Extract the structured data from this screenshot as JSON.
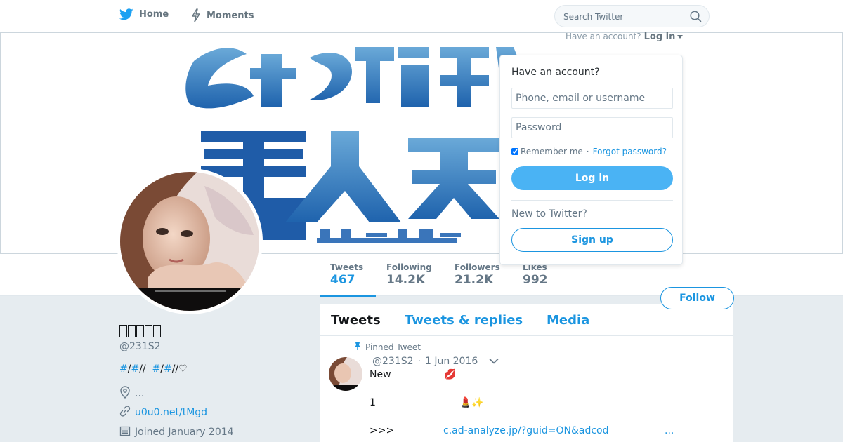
{
  "nav": {
    "home": "Home",
    "moments": "Moments",
    "search_placeholder": "Search Twitter"
  },
  "account_prompt": {
    "text": "Have an account?",
    "login": "Log in"
  },
  "login_card": {
    "heading": "Have an account?",
    "username_placeholder": "Phone, email or username",
    "password_placeholder": "Password",
    "remember": "Remember me",
    "separator": "·",
    "forgot": "Forgot password?",
    "login_button": "Log in",
    "new_label": "New to Twitter?",
    "signup_button": "Sign up"
  },
  "stats": {
    "tweets": {
      "label": "Tweets",
      "value": "467"
    },
    "following": {
      "label": "Following",
      "value": "14.2K"
    },
    "followers": {
      "label": "Followers",
      "value": "21.2K"
    },
    "likes": {
      "label": "Likes",
      "value": "992"
    }
  },
  "follow_button": "Follow",
  "profile": {
    "handle": "@231S2",
    "bio": {
      "h1": "#",
      "s1": "/",
      "h2": "#",
      "s2": "//  ",
      "h3": "#",
      "s3": "/",
      "h4": "#",
      "s4": "//♡"
    },
    "location": "...",
    "url": "u0u0.net/tMgd",
    "joined": "Joined January 2014"
  },
  "timeline": {
    "tabs": [
      "Tweets",
      "Tweets & replies",
      "Media"
    ],
    "pinned_label": "Pinned Tweet",
    "tweet": {
      "handle": "@231S2",
      "dot": "·",
      "date": "1 Jun 2016",
      "line1": "New",
      "line2": "1",
      "line3": ">>>",
      "link": "c.ad-analyze.jp/?guid=ON&adcod",
      "more": "...",
      "emoji1": "💋",
      "emoji2": "💄✨"
    }
  },
  "colors": {
    "accent": "#1b95e0",
    "login_button": "#4ab3f4",
    "page_bg": "#e6ecf0"
  }
}
